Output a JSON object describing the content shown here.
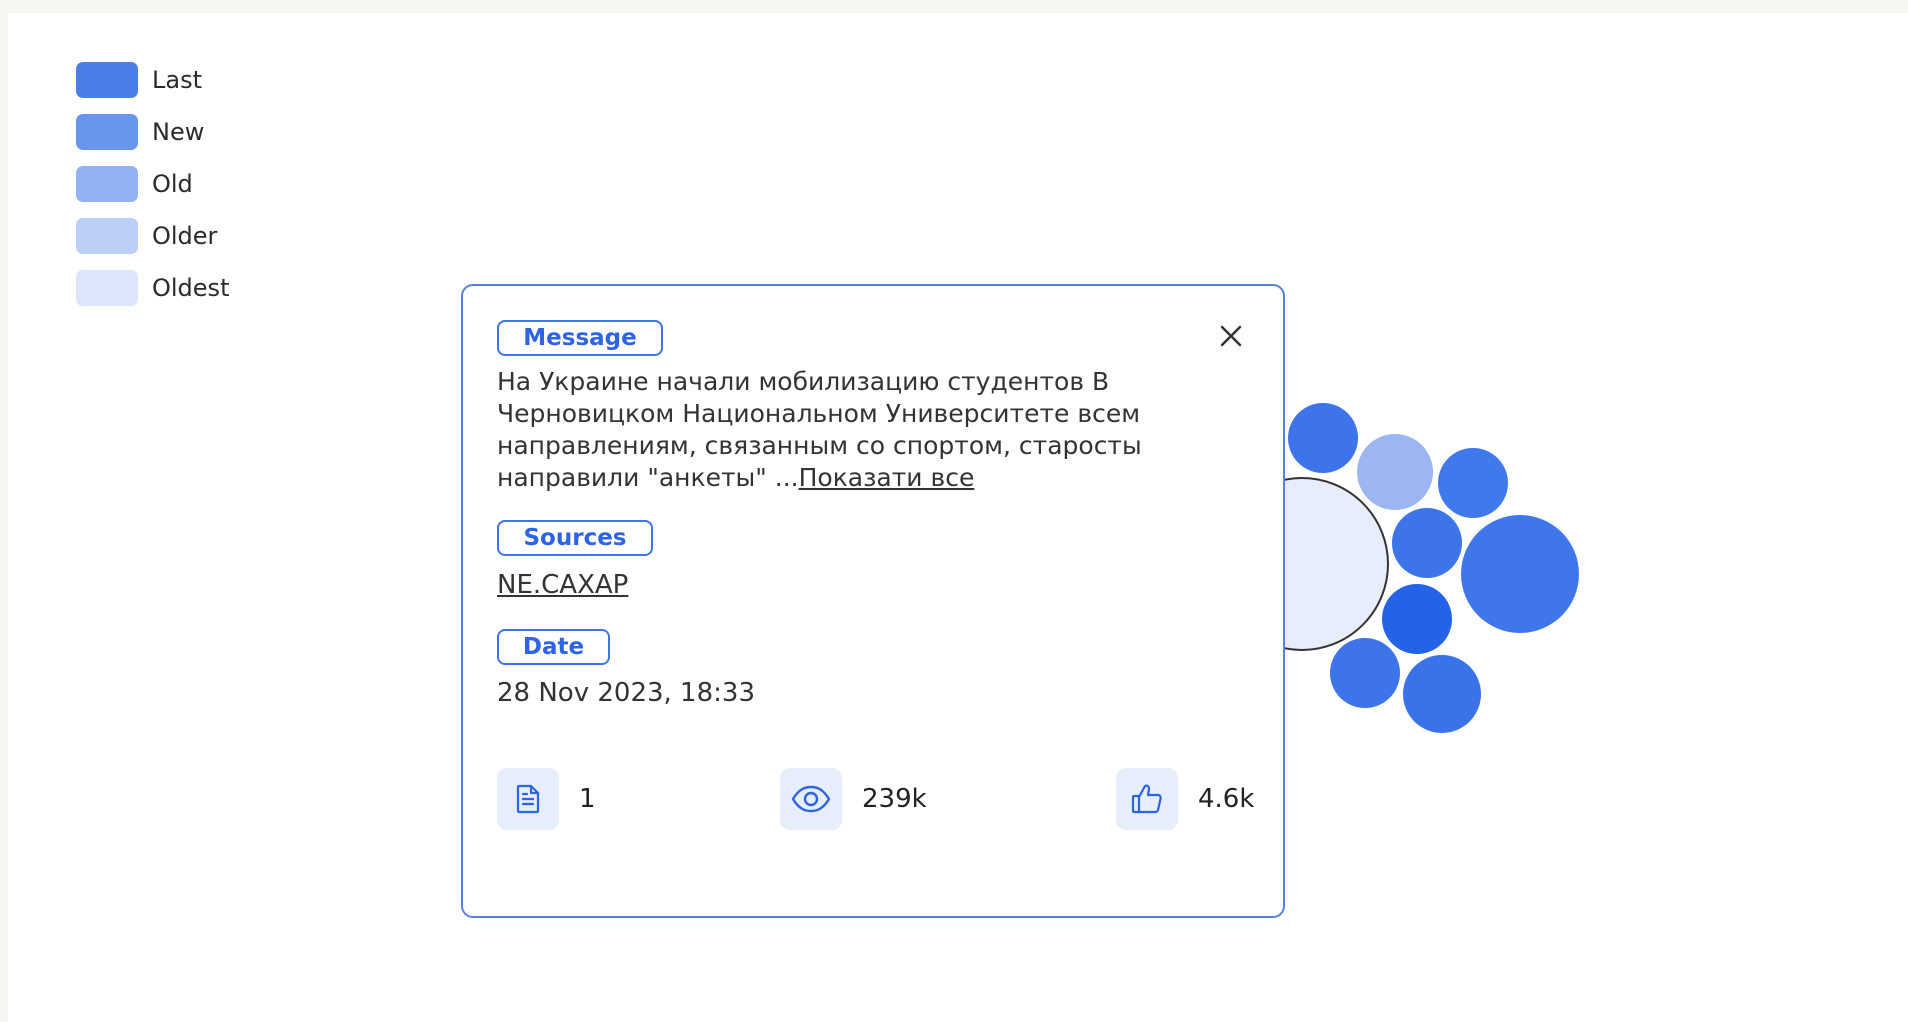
{
  "legend": {
    "items": [
      {
        "label": "Last",
        "color": "#4a7fea"
      },
      {
        "label": "New",
        "color": "#6a95ee"
      },
      {
        "label": "Old",
        "color": "#93b2f3"
      },
      {
        "label": "Older",
        "color": "#bccff8"
      },
      {
        "label": "Oldest",
        "color": "#dde6fb"
      }
    ]
  },
  "popup": {
    "message_tag": "Message",
    "message_text": "На Украине начали мобилизацию студентов В Черновицком Национальном Университете всем направлениям, связанным со спортом, старосты направили \"анкеты\" ...",
    "show_all_label": "Показати все",
    "sources_tag": "Sources",
    "source_name": "NE.CAXAP",
    "date_tag": "Date",
    "date_value": "28 Nov 2023, 18:33",
    "stats": {
      "documents": "1",
      "views": "239k",
      "likes": "4.6k"
    }
  },
  "colors": {
    "accent": "#3f74ee",
    "bubble_last": "#3d74ea",
    "bubble_dark": "#2563e6",
    "bubble_old": "#9bb6f3",
    "bubble_oldest": "#e7edfb"
  }
}
